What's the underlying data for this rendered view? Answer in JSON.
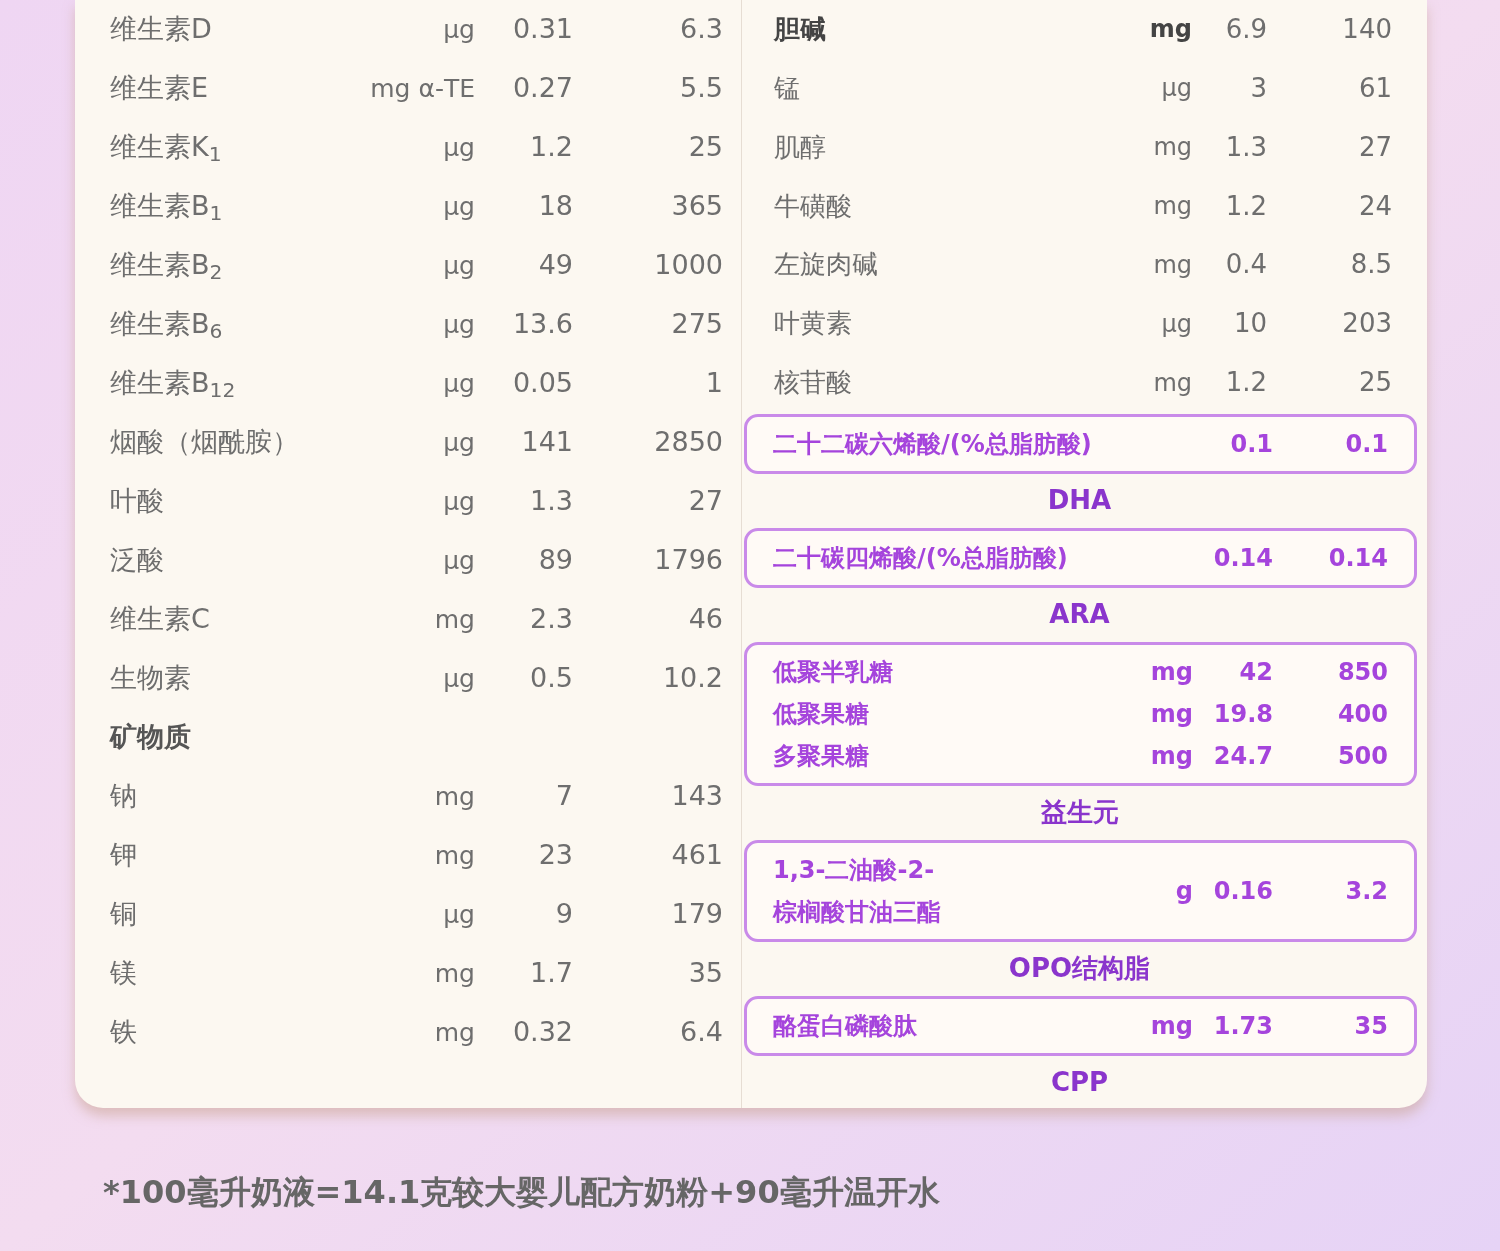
{
  "left_rows": [
    {
      "kind": "item",
      "name": "维生素D",
      "unit": "μg",
      "per_100kj": "0.31",
      "per_100g": "6.3"
    },
    {
      "kind": "item",
      "name": "维生素E",
      "unit": "mg α-TE",
      "per_100kj": "0.27",
      "per_100g": "5.5"
    },
    {
      "kind": "item",
      "name": "维生素K$_{1}$",
      "unit": "μg",
      "per_100kj": "1.2",
      "per_100g": "25"
    },
    {
      "kind": "item",
      "name": "维生素B$_{1}$",
      "unit": "μg",
      "per_100kj": "18",
      "per_100g": "365"
    },
    {
      "kind": "item",
      "name": "维生素B$_{2}$",
      "unit": "μg",
      "per_100kj": "49",
      "per_100g": "1000"
    },
    {
      "kind": "item",
      "name": "维生素B$_{6}$",
      "unit": "μg",
      "per_100kj": "13.6",
      "per_100g": "275"
    },
    {
      "kind": "item",
      "name": "维生素B$_{12}$",
      "unit": "μg",
      "per_100kj": "0.05",
      "per_100g": "1"
    },
    {
      "kind": "item",
      "name": "烟酸（烟酰胺）",
      "unit": "μg",
      "per_100kj": "141",
      "per_100g": "2850"
    },
    {
      "kind": "item",
      "name": "叶酸",
      "unit": "μg",
      "per_100kj": "1.3",
      "per_100g": "27"
    },
    {
      "kind": "item",
      "name": "泛酸",
      "unit": "μg",
      "per_100kj": "89",
      "per_100g": "1796"
    },
    {
      "kind": "item",
      "name": "维生素C",
      "unit": "mg",
      "per_100kj": "2.3",
      "per_100g": "46"
    },
    {
      "kind": "item",
      "name": "生物素",
      "unit": "μg",
      "per_100kj": "0.5",
      "per_100g": "10.2"
    },
    {
      "kind": "section",
      "name": "矿物质"
    },
    {
      "kind": "item",
      "name": "钠",
      "unit": "mg",
      "per_100kj": "7",
      "per_100g": "143"
    },
    {
      "kind": "item",
      "name": "钾",
      "unit": "mg",
      "per_100kj": "23",
      "per_100g": "461"
    },
    {
      "kind": "item",
      "name": "铜",
      "unit": "μg",
      "per_100kj": "9",
      "per_100g": "179"
    },
    {
      "kind": "item",
      "name": "镁",
      "unit": "mg",
      "per_100kj": "1.7",
      "per_100g": "35"
    },
    {
      "kind": "item",
      "name": "铁",
      "unit": "mg",
      "per_100kj": "0.32",
      "per_100g": "6.4"
    }
  ],
  "right_rows": [
    {
      "name": "胆碱",
      "bold": true,
      "unit": "mg",
      "per_100kj": "6.9",
      "per_100g": "140"
    },
    {
      "name": "锰",
      "bold": false,
      "unit": "μg",
      "per_100kj": "3",
      "per_100g": "61"
    },
    {
      "name": "肌醇",
      "bold": false,
      "unit": "mg",
      "per_100kj": "1.3",
      "per_100g": "27"
    },
    {
      "name": "牛磺酸",
      "bold": false,
      "unit": "mg",
      "per_100kj": "1.2",
      "per_100g": "24"
    },
    {
      "name": "左旋肉碱",
      "bold": false,
      "unit": "mg",
      "per_100kj": "0.4",
      "per_100g": "8.5"
    },
    {
      "name": "叶黄素",
      "bold": false,
      "unit": "μg",
      "per_100kj": "10",
      "per_100g": "203"
    },
    {
      "name": "核苷酸",
      "bold": false,
      "unit": "mg",
      "per_100kj": "1.2",
      "per_100g": "25"
    }
  ],
  "highlight_groups": [
    {
      "label": "DHA",
      "rows": [
        {
          "name_lines": [
            "二十二碳六烯酸/(%总脂肪酸)"
          ],
          "per_100kj": "0.1",
          "per_100g": "0.1"
        }
      ]
    },
    {
      "label": "ARA",
      "rows": [
        {
          "name_lines": [
            "二十碳四烯酸/(%总脂肪酸)"
          ],
          "per_100kj": "0.14",
          "per_100g": "0.14"
        }
      ]
    },
    {
      "label": "益生元",
      "rows": [
        {
          "name_lines": [
            "低聚半乳糖"
          ],
          "unit": "mg",
          "per_100kj": "42",
          "per_100g": "850"
        },
        {
          "name_lines": [
            "低聚果糖"
          ],
          "unit": "mg",
          "per_100kj": "19.8",
          "per_100g": "400"
        },
        {
          "name_lines": [
            "多聚果糖"
          ],
          "unit": "mg",
          "per_100kj": "24.7",
          "per_100g": "500"
        }
      ]
    },
    {
      "label": "OPO结构脂",
      "rows": [
        {
          "name_lines": [
            "1,3-二油酸-2-",
            "棕榈酸甘油三酯"
          ],
          "unit": "g",
          "per_100kj": "0.16",
          "per_100g": "3.2"
        }
      ]
    },
    {
      "label": "CPP",
      "rows": [
        {
          "name_lines": [
            "酪蛋白磷酸肽"
          ],
          "unit": "mg",
          "per_100kj": "1.73",
          "per_100g": "35"
        }
      ]
    }
  ],
  "footnote": "*100毫升奶液=14.1克较大婴儿配方奶粉+90毫升温开水"
}
